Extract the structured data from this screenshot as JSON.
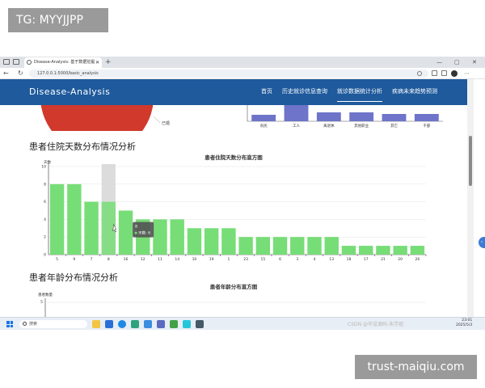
{
  "overlay": {
    "top_watermark": "TG: MYYJJPP",
    "bottom_watermark": "trust-maiqiu.com"
  },
  "browser": {
    "tab_title": "Disease-Analysis: 基于数据挖掘",
    "url": "127.0.0.1:5000/basic_analysis"
  },
  "site": {
    "brand": "Disease-Analysis",
    "nav": [
      "首页",
      "历史就诊信息查询",
      "就诊数据统计分析",
      "疾病未来趋势预测"
    ],
    "active_nav_index": 2
  },
  "top_chart_fragment": {
    "categories": [
      "农民",
      "工人",
      "离退休",
      "其他职业",
      "其它",
      "干部"
    ],
    "pie_label": "已婚",
    "colors": {
      "bar": "#6d74c9",
      "pie": "#d0392b"
    }
  },
  "section1": {
    "title": "患者住院天数分布情况分析",
    "chart_data": {
      "type": "bar",
      "title": "患者住院天数分布直方图",
      "ylabel": "天数",
      "categories": [
        "5",
        "9",
        "7",
        "8",
        "16",
        "12",
        "11",
        "14",
        "10",
        "19",
        "1",
        "23",
        "15",
        "6",
        "3",
        "4",
        "13",
        "18",
        "17",
        "21",
        "20",
        "26"
      ],
      "values": [
        8,
        8,
        6,
        6,
        5,
        4,
        4,
        4,
        3,
        3,
        3,
        2,
        2,
        2,
        2,
        2,
        2,
        1,
        1,
        1,
        1,
        1
      ],
      "ylim": [
        0,
        10
      ],
      "yticks": [
        "0",
        "2",
        "4",
        "6",
        "8",
        "10"
      ],
      "highlight_index": 3,
      "tooltip": {
        "category": "8",
        "series": "天数",
        "value": "6"
      },
      "colors": {
        "bar": "#77dd77",
        "highlight_band": "#d6d6d6",
        "tooltip_bg": "#555555"
      }
    }
  },
  "section2": {
    "title": "患者年龄分布情况分析",
    "chart_title": "患者年龄分布直方图",
    "ylabel": "患者数量",
    "first_tick": "5"
  },
  "taskbar": {
    "search_placeholder": "搜索",
    "time": "23:01",
    "date": "2025/5/3",
    "csdn_watermark": "CSDN @毕设源码-朱学姐"
  }
}
